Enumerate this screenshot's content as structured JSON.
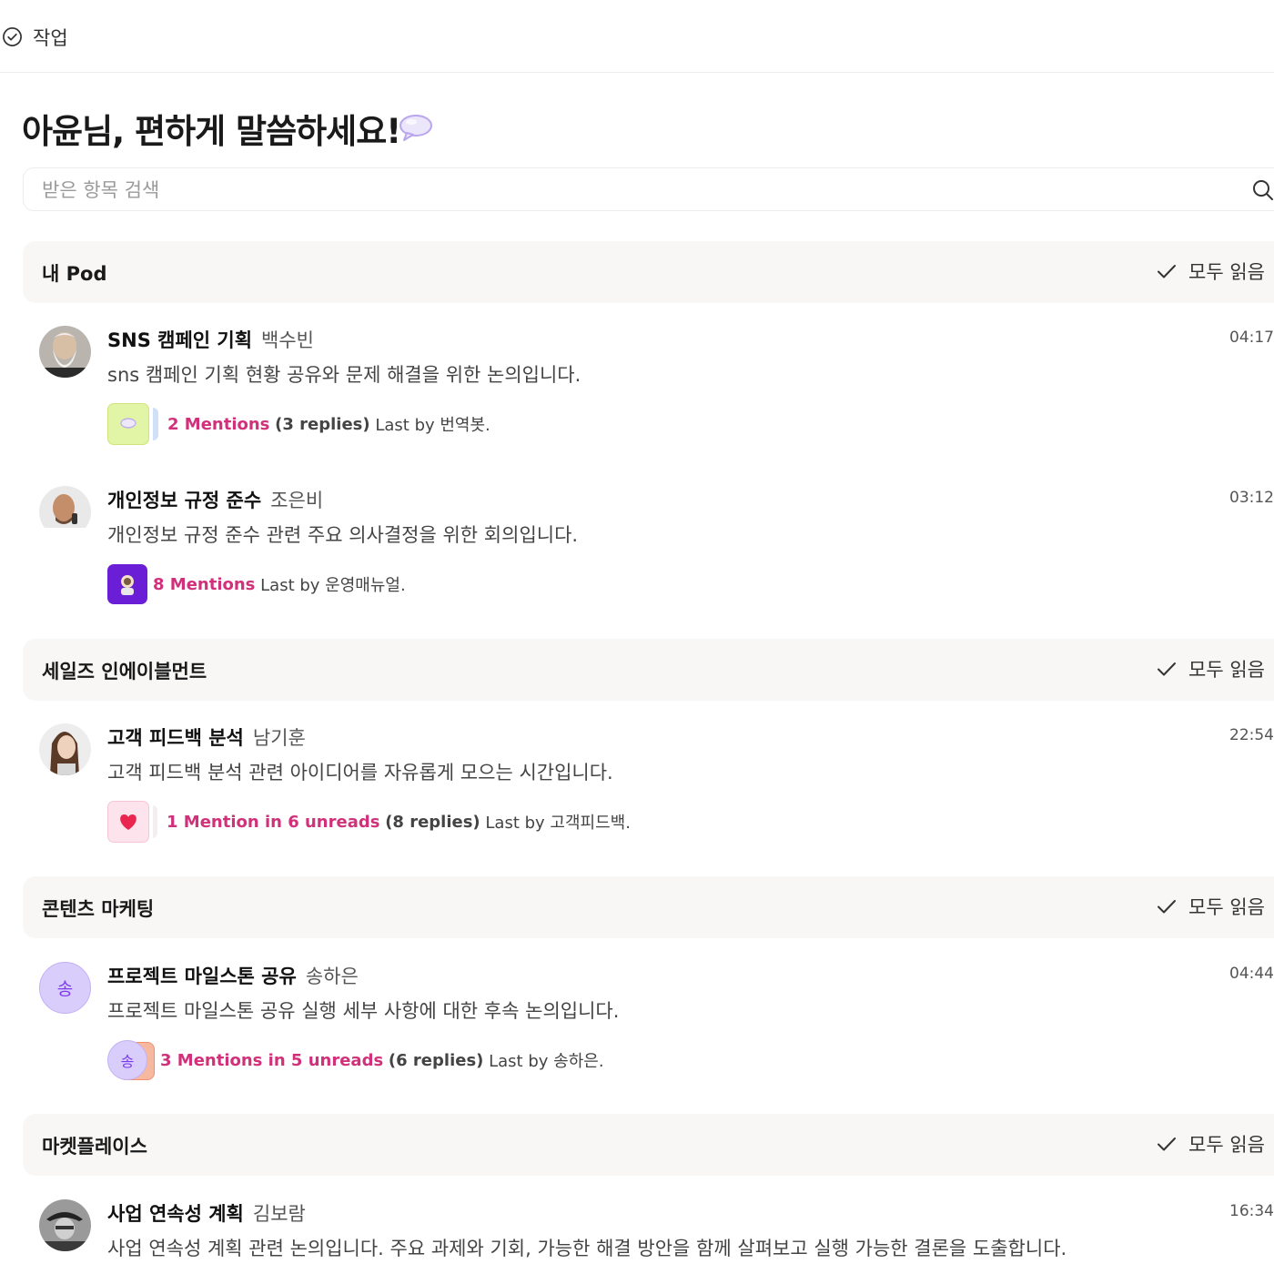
{
  "topbar": {
    "tab_label": "작업",
    "icon": "check-circle-icon"
  },
  "greeting": {
    "text": "아윤님, 편하게 말씀하세요!",
    "icon": "speech-bubble-icon"
  },
  "search": {
    "placeholder": "받은 항목 검색",
    "icon": "search-icon"
  },
  "mark_all_label": "모두 읽음",
  "sections": [
    {
      "title": "내 Pod"
    },
    {
      "title": "세일즈 인에이블먼트"
    },
    {
      "title": "콘텐츠 마케팅"
    },
    {
      "title": "마켓플레이스"
    }
  ],
  "threads": [
    {
      "title": "SNS 캠페인 기획",
      "author": "백수빈",
      "time": "04:17",
      "desc": "sns 캠페인 기획 현황 공유와 문제 해결을 위한 논의입니다.",
      "mentions": "2 Mentions",
      "replies": "(3 replies)",
      "last_by": "Last by 번역봇."
    },
    {
      "title": "개인정보 규정 준수",
      "author": "조은비",
      "time": "03:12",
      "desc": "개인정보 규정 준수 관련 주요 의사결정을 위한 회의입니다.",
      "mentions": "8 Mentions",
      "replies": "",
      "last_by": "Last by 운영매뉴얼."
    },
    {
      "title": "고객 피드백 분석",
      "author": "남기훈",
      "time": "22:54",
      "desc": "고객 피드백 분석 관련 아이디어를 자유롭게 모으는 시간입니다.",
      "mentions": "1 Mention in 6 unreads",
      "replies": "(8 replies)",
      "last_by": "Last by 고객피드백."
    },
    {
      "title": "프로젝트 마일스톤 공유",
      "author": "송하은",
      "time": "04:44",
      "desc": "프로젝트 마일스톤 공유 실행 세부 사항에 대한 후속 논의입니다.",
      "avatar_initial": "송",
      "chip_initial": "송",
      "mentions": "3 Mentions in 5 unreads",
      "replies": "(6 replies)",
      "last_by": "Last by 송하은."
    },
    {
      "title": "사업 연속성 계획",
      "author": "김보람",
      "time": "16:34",
      "desc": "사업 연속성 계획 관련 논의입니다. 주요 과제와 기회, 가능한 해결 방안을 함께 살펴보고 실행 가능한 결론을 도출합니다."
    }
  ],
  "colors": {
    "mention": "#d1307a",
    "section_bg": "#f8f7f6",
    "avatar_purple": "#c9b8f7"
  }
}
